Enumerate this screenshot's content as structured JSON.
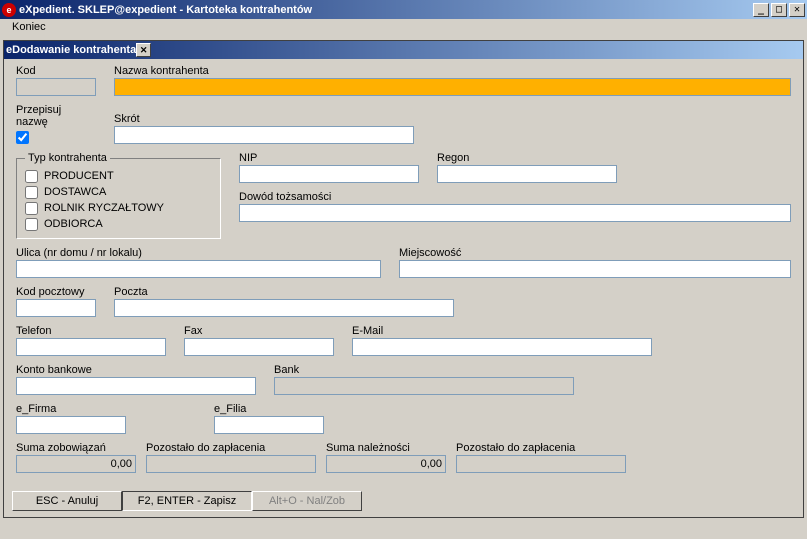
{
  "window": {
    "title": "eXpedient. SKLEP@expedient  - Kartoteka kontrahentów"
  },
  "menu": {
    "koniec": "Koniec"
  },
  "subwindow": {
    "title": "Dodawanie kontrahenta"
  },
  "labels": {
    "kod": "Kod",
    "nazwa": "Nazwa kontrahenta",
    "przepisuj": "Przepisuj nazwę",
    "skrot": "Skrót",
    "typ": "Typ kontrahenta",
    "producent": "PRODUCENT",
    "dostawca": "DOSTAWCA",
    "rolnik": "ROLNIK RYCZAŁTOWY",
    "odbiorca": "ODBIORCA",
    "nip": "NIP",
    "regon": "Regon",
    "dowod": "Dowód tożsamości",
    "ulica": "Ulica (nr domu / nr lokalu)",
    "miejsc": "Miejscowość",
    "kodp": "Kod pocztowy",
    "poczta": "Poczta",
    "telefon": "Telefon",
    "fax": "Fax",
    "email": "E-Mail",
    "konto": "Konto bankowe",
    "bank": "Bank",
    "efirma": "e_Firma",
    "efilia": "e_Filia",
    "sumazob": "Suma zobowiązań",
    "pozostalo1": "Pozostało do zapłacenia",
    "sumanal": "Suma należności",
    "pozostalo2": "Pozostało do zapłacenia"
  },
  "values": {
    "kod": "",
    "nazwa": "",
    "skrot": "",
    "nip": "",
    "regon": "",
    "dowod": "",
    "ulica": "",
    "miejsc": "",
    "kodp": "",
    "poczta": "",
    "telefon": "",
    "fax": "",
    "email": "",
    "konto": "",
    "bank": "",
    "efirma": "",
    "efilia": "",
    "sumazob": "0,00",
    "pozostalo1": "",
    "sumanal": "0,00",
    "pozostalo2": ""
  },
  "buttons": {
    "esc": "ESC - Anuluj",
    "save": "F2, ENTER - Zapisz",
    "alt": "Alt+O - Nal/Zob"
  }
}
